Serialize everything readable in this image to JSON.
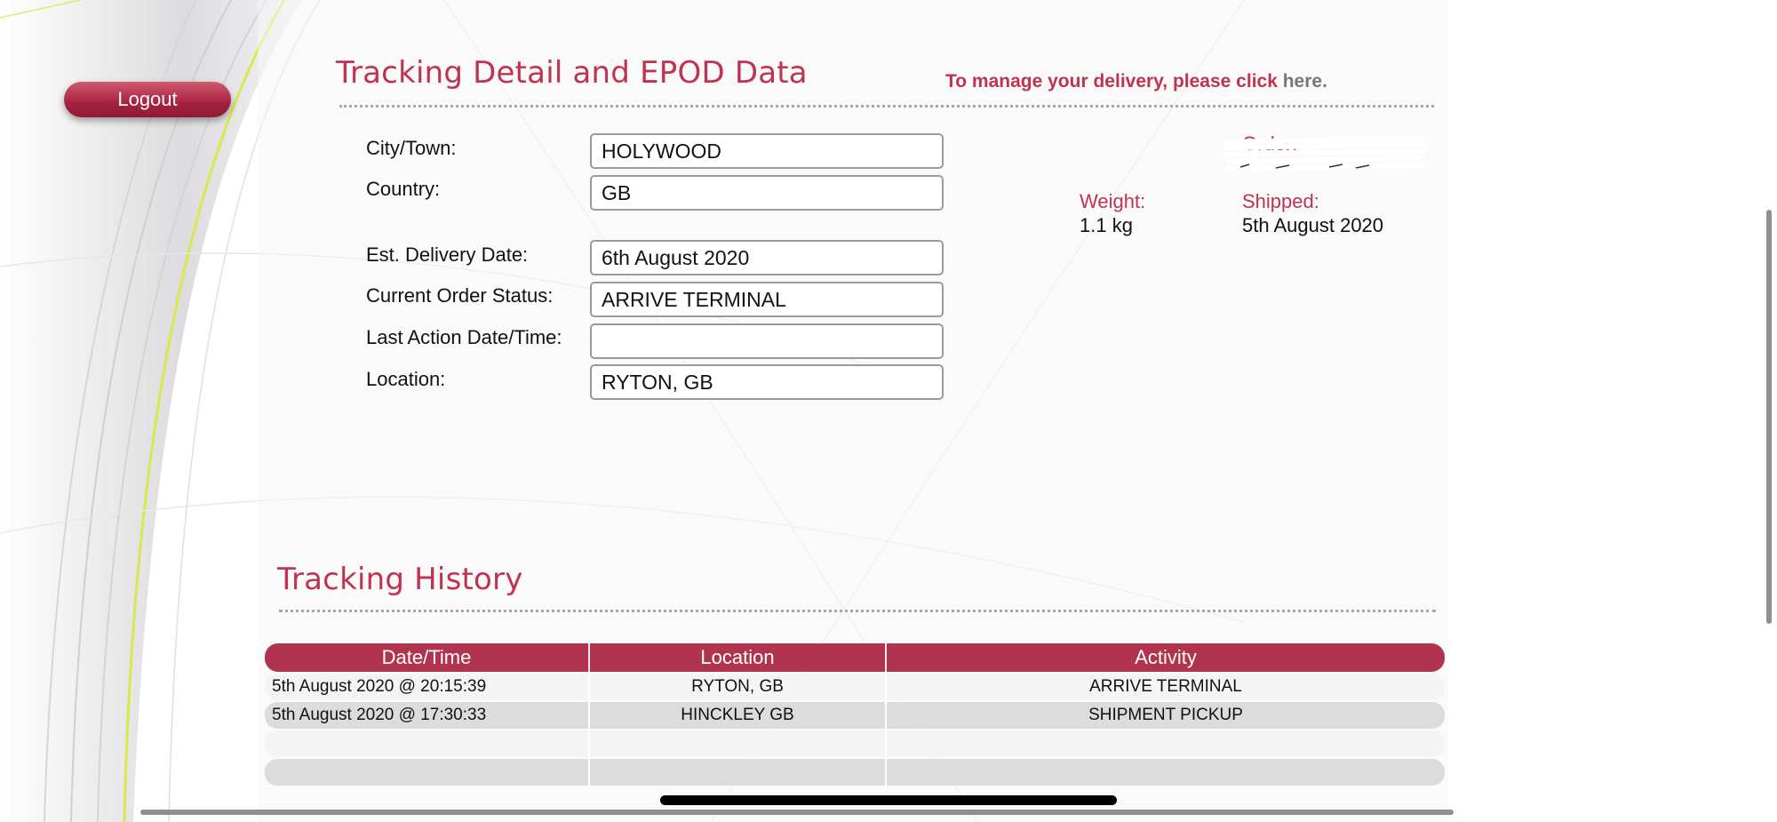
{
  "logout_label": "Logout",
  "detail_title": "Tracking Detail and EPOD Data",
  "manage": {
    "text": "To manage your delivery, please click ",
    "link": "here."
  },
  "fields": {
    "city": {
      "label": "City/Town:",
      "value": "HOLYWOOD"
    },
    "country": {
      "label": "Country:",
      "value": "GB"
    },
    "est_delivery": {
      "label": "Est. Delivery Date:",
      "value": "6th August 2020"
    },
    "status": {
      "label": "Current Order Status:",
      "value": "ARRIVE TERMINAL"
    },
    "last_action": {
      "label": "Last Action Date/Time:",
      "value": ""
    },
    "location": {
      "label": "Location:",
      "value": "RYTON, GB"
    }
  },
  "info": {
    "order_label": "Order:",
    "weight_label": "Weight:",
    "weight_value": "1.1 kg",
    "shipped_label": "Shipped:",
    "shipped_value": "5th August 2020"
  },
  "history_title": "Tracking History",
  "history": {
    "headers": [
      "Date/Time",
      "Location",
      "Activity"
    ],
    "rows": [
      [
        "5th August 2020 @ 20:15:39",
        "RYTON, GB",
        "ARRIVE TERMINAL"
      ],
      [
        "5th August 2020 @ 17:30:33",
        "HINCKLEY GB",
        "SHIPMENT PICKUP"
      ],
      [
        "",
        "",
        ""
      ],
      [
        "",
        "",
        ""
      ]
    ]
  },
  "colors": {
    "accent": "#c0334f",
    "header_row": "#b0344f",
    "logout": "#a8213e"
  }
}
